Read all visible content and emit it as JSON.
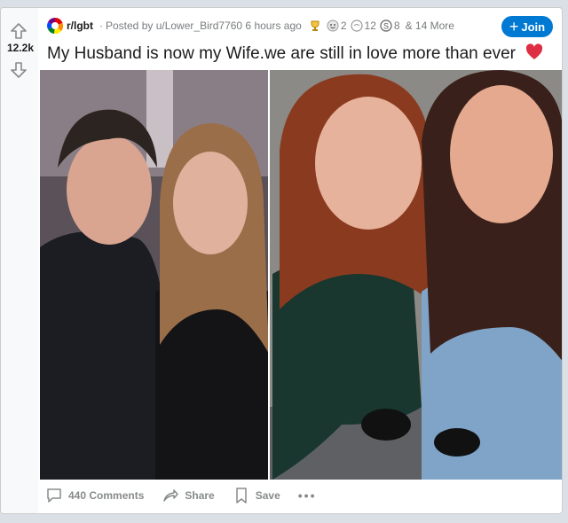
{
  "post": {
    "votes": "12.2k",
    "subreddit": "r/lgbt",
    "posted_by": "Posted by u/Lower_Bird7760 6 hours ago",
    "awards": [
      {
        "icon": "trophy-award-icon",
        "count": ""
      },
      {
        "icon": "wholesome-award-icon",
        "count": "2"
      },
      {
        "icon": "silver-award-icon",
        "count": "12"
      },
      {
        "icon": "helpful-award-icon",
        "count": "8"
      }
    ],
    "awards_more": "& 14 More",
    "join_label": "Join",
    "title": "My Husband is now my Wife.we are still in love more than ever",
    "title_emoji": "heart-emoji-icon"
  },
  "actions": {
    "comments_label": "440 Comments",
    "share_label": "Share",
    "save_label": "Save",
    "more_label": "•••"
  },
  "colors": {
    "accent": "#0079d3",
    "page_bg": "#dae0e6",
    "meta_text": "#787c7e"
  }
}
